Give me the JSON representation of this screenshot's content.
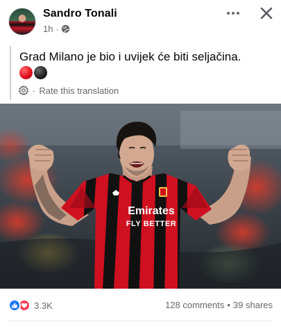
{
  "post": {
    "author": "Sandro Tonali",
    "time": "1h",
    "separator": "·",
    "text": "Grad Milano je bio i uvijek će biti seljačina.",
    "rate_translation": "Rate this translation",
    "rate_separator": "·",
    "image": {
      "shirt_sponsor_line1": "Emirates",
      "shirt_sponsor_line2": "FLY BETTER"
    }
  },
  "footer": {
    "reaction_count": "3.3K",
    "comments": "128 comments",
    "stat_separator": "•",
    "shares": "39 shares"
  },
  "icons": {
    "avatar": "profile-photo",
    "privacy": "globe-icon",
    "more": "more-dots-icon",
    "close": "close-icon",
    "rate": "gear-icon",
    "reactions": [
      "like-icon",
      "love-icon"
    ]
  },
  "colors": {
    "like": "#1877f2",
    "love": "#f33e58",
    "secondary_text": "#65676b",
    "milan_red": "#d4101e"
  }
}
